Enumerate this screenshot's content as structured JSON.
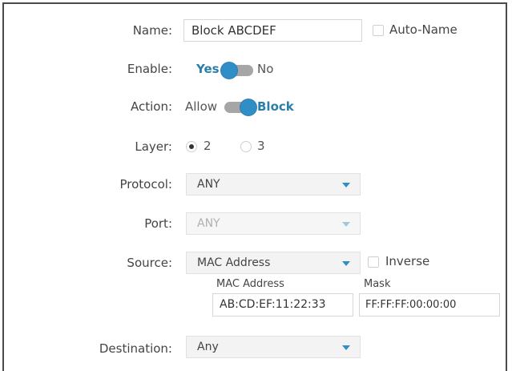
{
  "form": {
    "name": {
      "label": "Name:",
      "value": "Block ABCDEF",
      "auto_name_label": "Auto-Name",
      "auto_name_checked": false
    },
    "enable": {
      "label": "Enable:",
      "on_label": "Yes",
      "off_label": "No",
      "state": "Yes"
    },
    "action": {
      "label": "Action:",
      "left_label": "Allow",
      "right_label": "Block",
      "state": "Block"
    },
    "layer": {
      "label": "Layer:",
      "options": [
        "2",
        "3"
      ],
      "selected": "2"
    },
    "protocol": {
      "label": "Protocol:",
      "value": "ANY"
    },
    "port": {
      "label": "Port:",
      "value": "ANY",
      "disabled": true
    },
    "source": {
      "label": "Source:",
      "value": "MAC Address",
      "inverse_label": "Inverse",
      "inverse_checked": false,
      "mac_label": "MAC Address",
      "mac_value": "AB:CD:EF:11:22:33",
      "mask_label": "Mask",
      "mask_value": "FF:FF:FF:00:00:00"
    },
    "destination": {
      "label": "Destination:",
      "value": "Any"
    }
  },
  "colors": {
    "accent": "#2f8ec6",
    "active_text": "#2b7ea8",
    "track": "#a6a6a6"
  }
}
